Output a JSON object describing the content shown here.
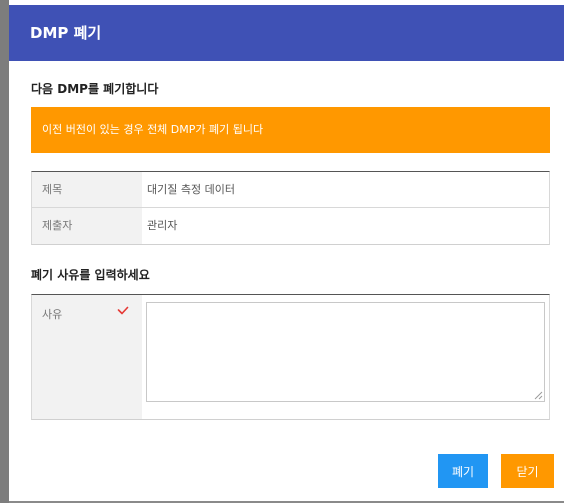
{
  "dialog": {
    "title": "DMP 폐기",
    "heading": "다음 DMP를 폐기합니다",
    "warning": "이전 버전이 있는 경우 전체 DMP가 폐기 됩니다",
    "info": {
      "rows": [
        {
          "label": "제목",
          "value": "대기질 측정 데이터"
        },
        {
          "label": "제출자",
          "value": "관리자"
        }
      ]
    },
    "reason_heading": "폐기 사유를 입력하세요",
    "reason": {
      "label": "사유",
      "required_icon": "check-icon",
      "value": ""
    },
    "buttons": {
      "discard": "폐기",
      "close": "닫기"
    }
  },
  "colors": {
    "title_bar": "#3f51b5",
    "warning": "#ff9800",
    "discard_button": "#2196f3",
    "close_button": "#ff9800",
    "required_check": "#e53935"
  }
}
